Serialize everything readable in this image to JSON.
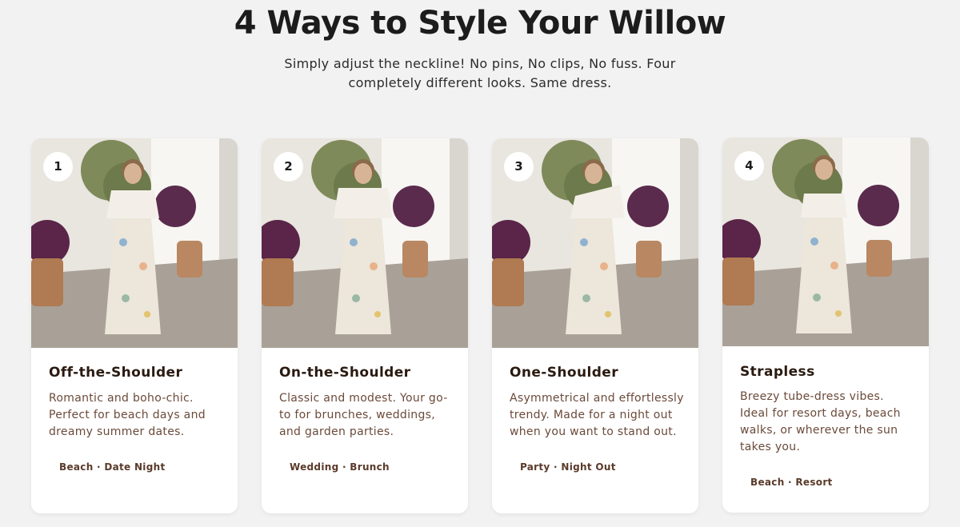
{
  "header": {
    "title": "4 Ways to Style Your Willow",
    "subtitle": "Simply adjust the neckline! No pins, No clips, No fuss. Four completely different looks. Same dress."
  },
  "cards": [
    {
      "number": "1",
      "title": "Off-the-Shoulder",
      "description": "Romantic and boho-chic. Perfect for beach days and dreamy summer dates.",
      "tags": "Beach · Date Night"
    },
    {
      "number": "2",
      "title": "On-the-Shoulder",
      "description": "Classic and modest. Your go-to for brunches, weddings, and garden parties.",
      "tags": "Wedding · Brunch"
    },
    {
      "number": "3",
      "title": "One-Shoulder",
      "description": "Asymmetrical and effortlessly trendy. Made for a night out when you want to stand out.",
      "tags": "Party · Night Out"
    },
    {
      "number": "4",
      "title": "Strapless",
      "description": "Breezy tube-dress vibes. Ideal for resort days, beach walks, or wherever the sun takes you.",
      "tags": "Beach · Resort"
    }
  ],
  "colors": {
    "background": "#f2f2f2",
    "card": "#ffffff",
    "heading": "#1c1c1c",
    "card_title": "#2a1a10",
    "card_text": "#6b4a3a"
  }
}
